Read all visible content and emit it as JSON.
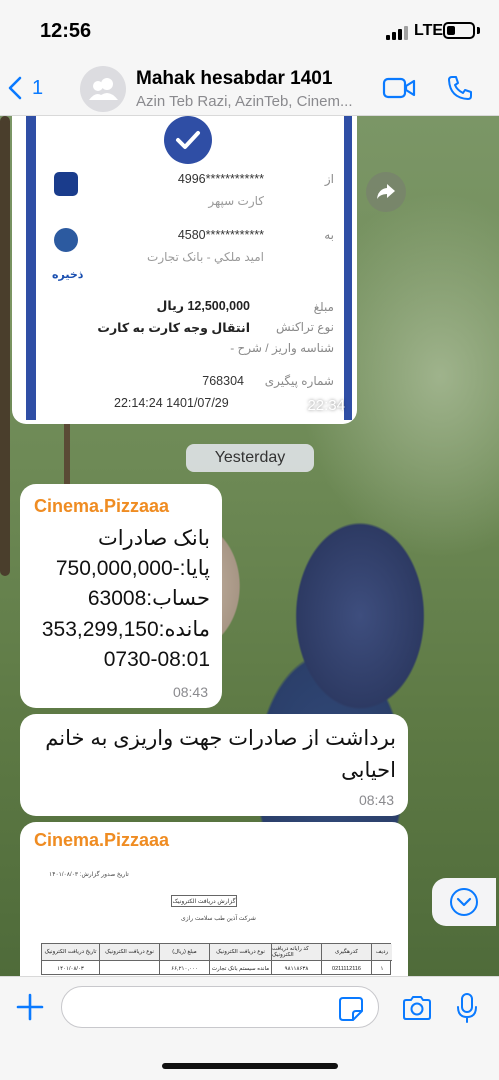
{
  "status_bar": {
    "time": "12:56",
    "network": "LTE"
  },
  "header": {
    "back_count": "1",
    "title": "Mahak hesabdar 1401",
    "subtitle": "Azin Teb Razi, AzinTeb, Cinem...",
    "accent_color": "#0a7aff",
    "icons": [
      "chevron-left-icon",
      "group-avatar-icon",
      "video-camera-icon",
      "phone-icon"
    ]
  },
  "receipt": {
    "from_label": "از",
    "from_card": "************4996",
    "from_card_name": "کارت سپهر",
    "to_label": "به",
    "to_card": "************4580",
    "to_name": "امید ملکي - بانک  تجارت",
    "to_bank_tag": "ذخیره",
    "amount_label": "مبلغ",
    "amount": "12,500,000 ریال",
    "txn_type_label": "نوع تراکنش",
    "txn_type": "انتقال وجه کارت به کارت",
    "deposit_id_label": "شناسه واریز / شرح -",
    "tracking_label": "شماره پیگیری",
    "tracking_number": "768304",
    "datetime": "22:14:24   1401/07/29",
    "time": "22:34"
  },
  "date_divider": "Yesterday",
  "message1": {
    "sender": "Cinema.Pizzaaa",
    "lines": [
      "بانک صادرات",
      "پایا:-750,000,000",
      "حساب:63008",
      "مانده:353,299,150",
      "0730-08:01"
    ],
    "time": "08:43"
  },
  "message2": {
    "lines": [
      "برداشت از صادرات جهت واریزی به خانم",
      "احیابی"
    ],
    "time": "08:43"
  },
  "message3": {
    "sender": "Cinema.Pizzaaa",
    "doc_title": "گزارش دریافت الکترونیک",
    "doc_date": "تاریخ صدور گزارش: ۱۴۰۱/۰۸/۰۳",
    "doc_company": "شرکت آذین طب سلامت رازی",
    "doc_table_headers": [
      "ردیف",
      "کدرهگیری",
      "کد رایانه دریافت الکترونیک",
      "نوع دریافت الکترونیک",
      "مبلغ (ریال)",
      "نوع دریافت الکترونیک",
      "تاریخ دریافت الکترونیک"
    ],
    "doc_table_row": [
      "۱",
      "0211112116",
      "۹۸۱۱۸۶۳۸",
      "مانده سیستم بانک تجارت",
      "۶۶,۲۱۰,۰۰۰",
      "",
      "۱۴۰۱/۰۸/۰۳"
    ]
  },
  "input_bar": {
    "placeholder": ""
  }
}
